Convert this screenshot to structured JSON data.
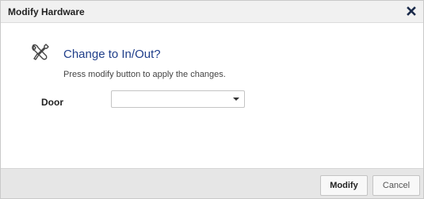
{
  "dialog": {
    "title": "Modify Hardware",
    "close_icon": "close-icon"
  },
  "content": {
    "icon": "tools-icon",
    "heading": "Change to In/Out?",
    "subtext": "Press modify button to apply the changes."
  },
  "form": {
    "door_label": "Door",
    "door_value": ""
  },
  "footer": {
    "modify_label": "Modify",
    "cancel_label": "Cancel"
  }
}
